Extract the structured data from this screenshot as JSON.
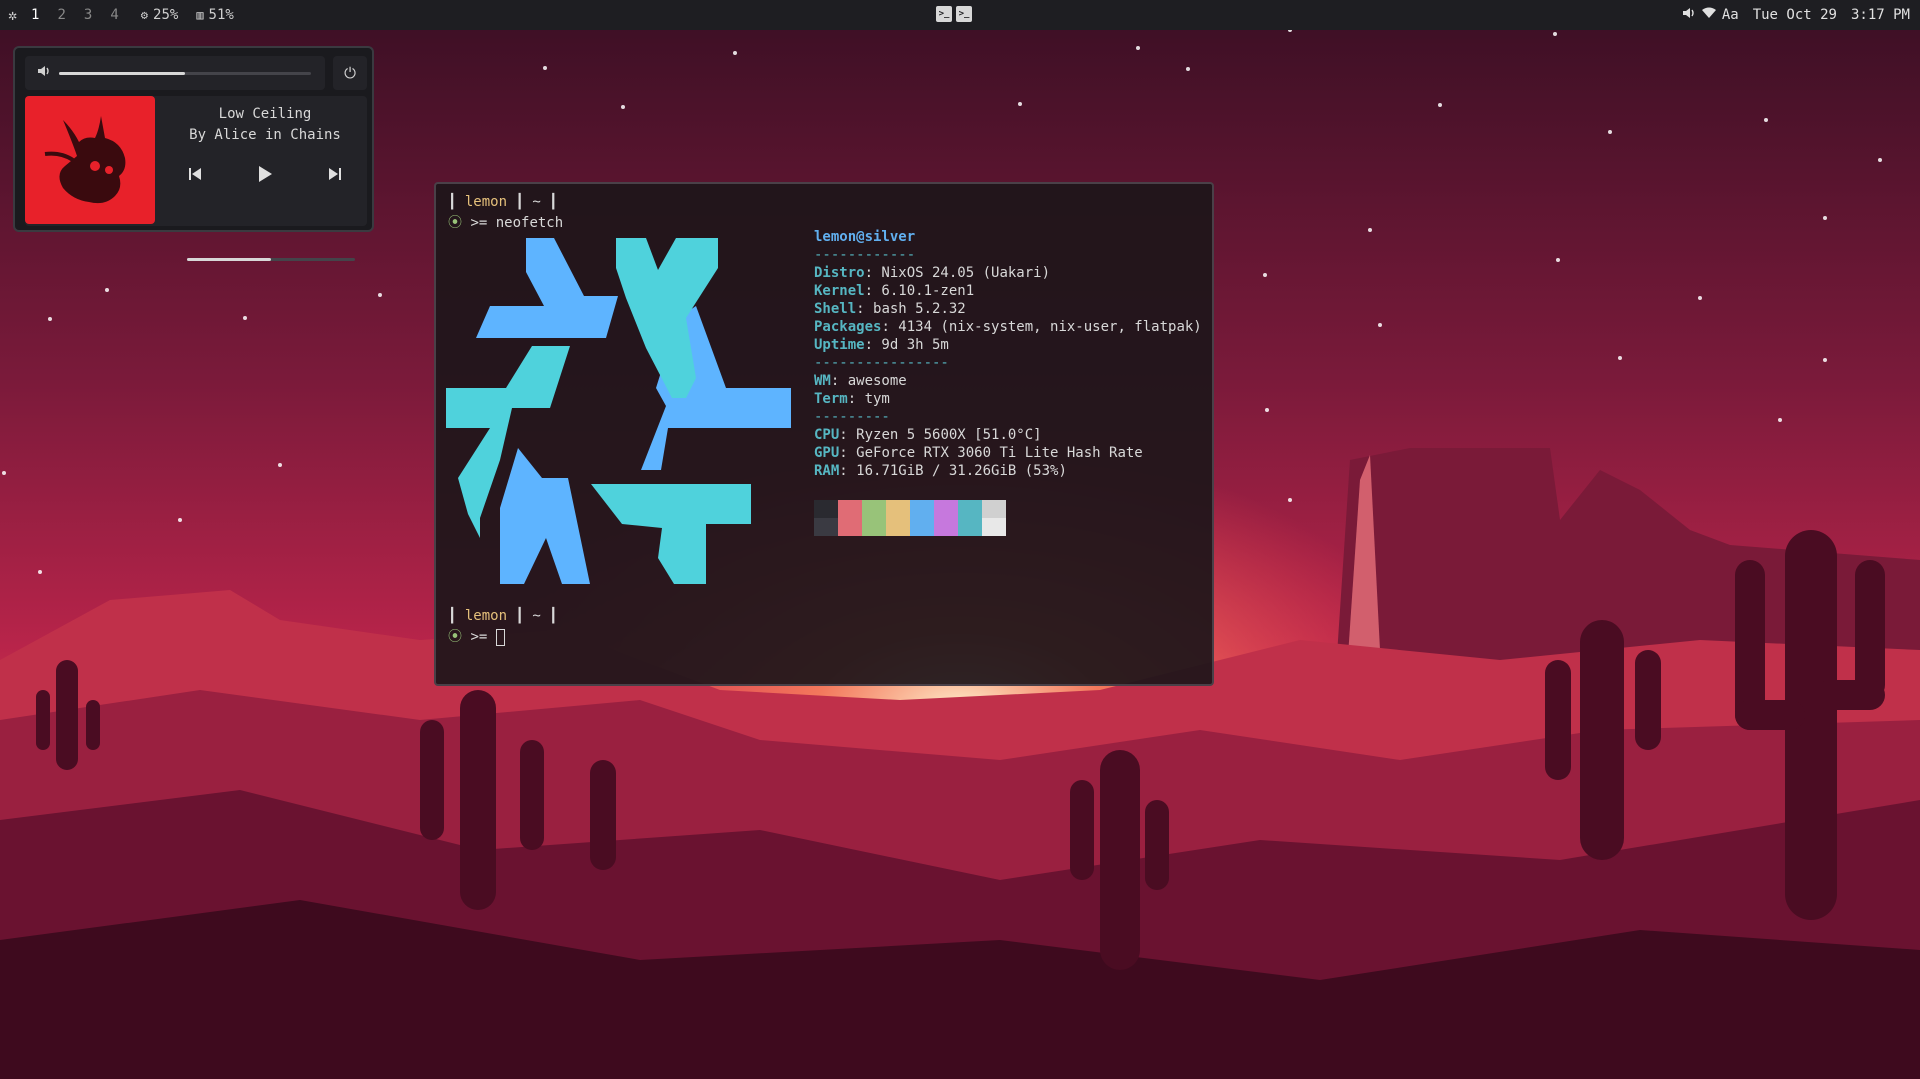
{
  "topbar": {
    "launcher_icon": "gear-icon",
    "tags": [
      "1",
      "2",
      "3",
      "4"
    ],
    "active_tag": "1",
    "cpu": "25%",
    "mem": "51%",
    "right_icons": [
      "volume-icon",
      "wifi-icon"
    ],
    "keyboard": "Aa",
    "date": "Tue Oct 29",
    "time": "3:17 PM"
  },
  "music": {
    "title": "Low Ceiling",
    "artist": "By Alice in Chains",
    "volume_level": 0.5,
    "progress_level": 0.5,
    "cover_color": "#e8212a"
  },
  "terminal": {
    "prompt_user": "lemon",
    "prompt_dir": "~",
    "command": "neofetch",
    "prompt_symbol": ">=",
    "info_title": "lemon@silver",
    "sep1": "------------",
    "distro_key": "Distro",
    "distro_val": ": NixOS 24.05 (Uakari)",
    "kernel_key": "Kernel",
    "kernel_val": ": 6.10.1-zen1",
    "shell_key": "Shell",
    "shell_val": ": bash 5.2.32",
    "packages_key": "Packages",
    "packages_val": ": 4134 (nix-system, nix-user, flatpak)",
    "uptime_key": "Uptime",
    "uptime_val": ": 9d 3h 5m",
    "sep2": "----------------",
    "wm_key": "WM",
    "wm_val": ": awesome",
    "term_key": "Term",
    "term_val": ": tym",
    "sep3": "---------",
    "cpu_key": "CPU",
    "cpu_val": ": Ryzen 5 5600X [51.0°C]",
    "gpu_key": "GPU",
    "gpu_val": ": GeForce RTX 3060 Ti Lite Hash Rate",
    "ram_key": "RAM",
    "ram_val": ": 16.71GiB / 31.26GiB (53%)",
    "palette_top": [
      "#2a2a30",
      "#e06c75",
      "#98c379",
      "#e5c07b",
      "#61afef",
      "#c678dd",
      "#56b6c2",
      "#d0d0d0"
    ],
    "palette_bottom": [
      "#3a3a42",
      "#e06c75",
      "#98c379",
      "#e5c07b",
      "#61afef",
      "#c678dd",
      "#56b6c2",
      "#e8e8e8"
    ],
    "logo_colors": [
      "#5eb4ff",
      "#4fd2dc"
    ]
  }
}
